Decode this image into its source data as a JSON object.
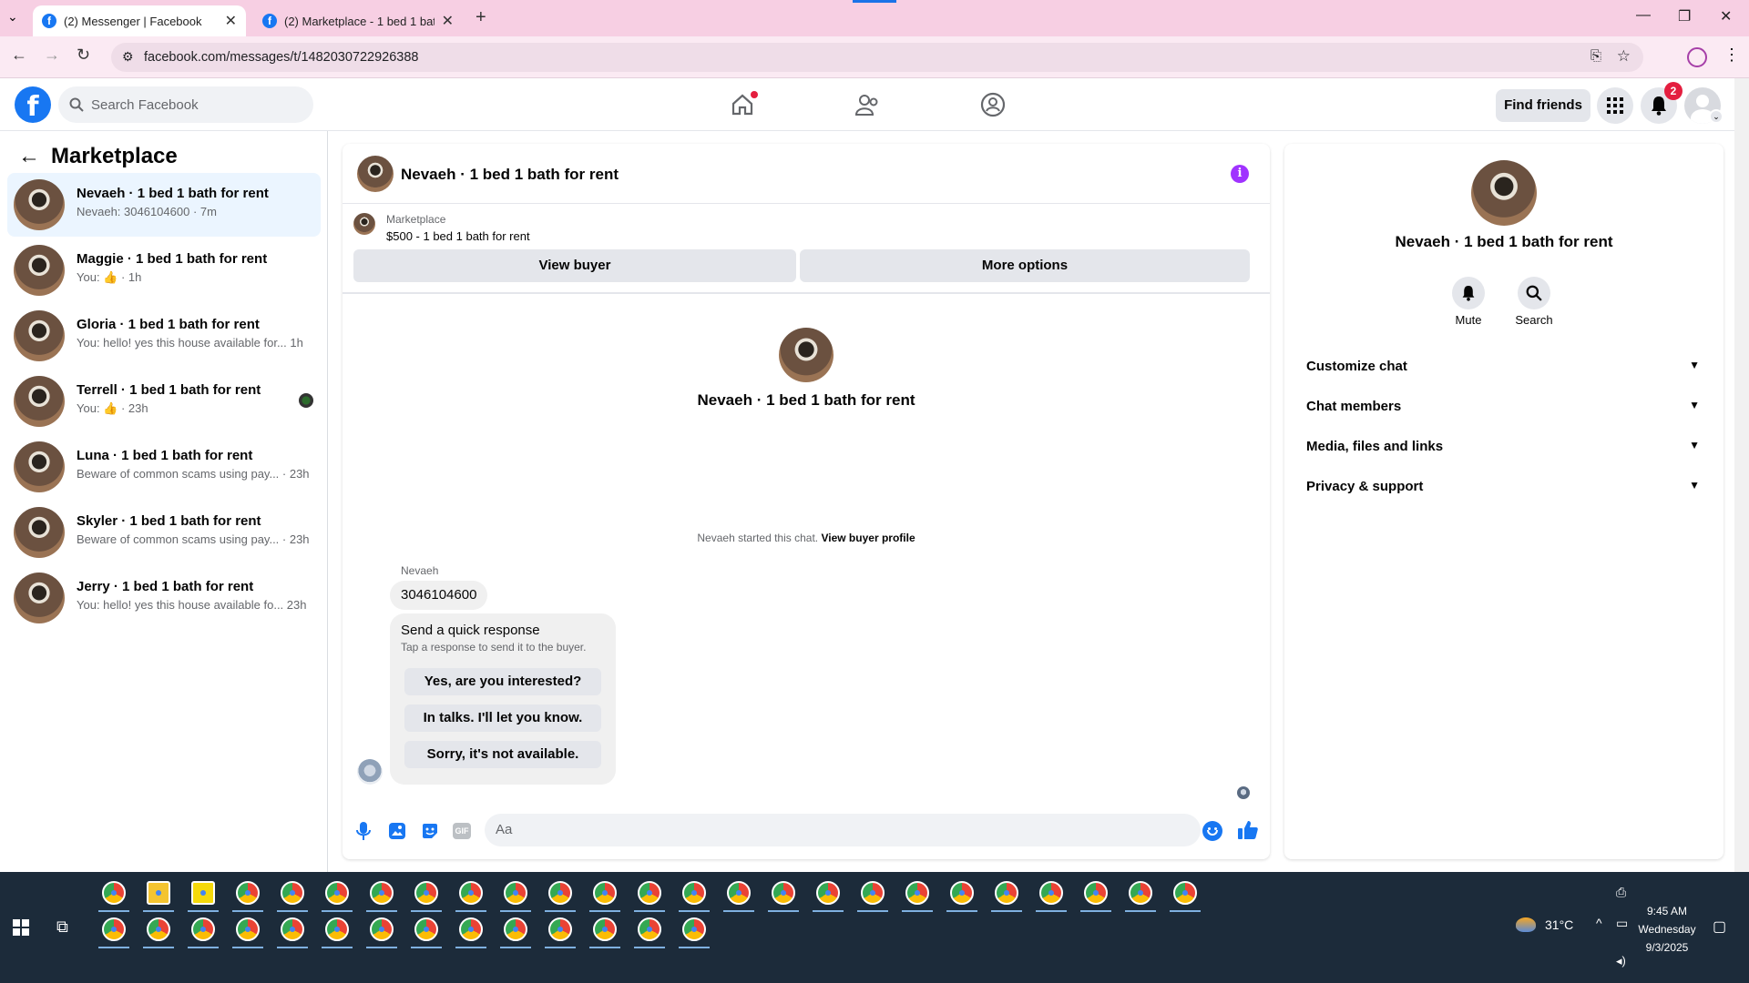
{
  "browser": {
    "tabs": [
      {
        "title": "(2) Messenger | Facebook",
        "active": true
      },
      {
        "title": "(2) Marketplace - 1 bed 1 bath",
        "active": false
      }
    ],
    "url": "facebook.com/messages/t/1482030722926388"
  },
  "fb_header": {
    "logo": "f",
    "search_placeholder": "Search Facebook",
    "find_friends": "Find friends",
    "notification_count": "2"
  },
  "left": {
    "title": "Marketplace",
    "conversations": [
      {
        "name": "Nevaeh · 1 bed 1 bath for rent",
        "preview": "Nevaeh: 3046104600 · 7m",
        "selected": true
      },
      {
        "name": "Maggie · 1 bed 1 bath for rent",
        "preview": "You: 👍 · 1h"
      },
      {
        "name": "Gloria · 1 bed 1 bath for rent",
        "preview": "You: hello! yes this house available for...  1h"
      },
      {
        "name": "Terrell · 1 bed 1 bath for rent",
        "preview": "You: 👍 · 23h"
      },
      {
        "name": "Luna · 1 bed 1 bath for rent",
        "preview": "Beware of common scams using pay... · 23h"
      },
      {
        "name": "Skyler · 1 bed 1 bath for rent",
        "preview": "Beware of common scams using pay... · 23h"
      },
      {
        "name": "Jerry · 1 bed 1 bath for rent",
        "preview": "You: hello! yes this house available fo... 23h"
      }
    ]
  },
  "chat": {
    "title": "Nevaeh · 1 bed 1 bath for rent",
    "listing_source": "Marketplace",
    "listing_line": "$500 - 1 bed 1 bath for rent",
    "view_buyer": "View buyer",
    "more_options": "More options",
    "center_name": "Nevaeh · 1 bed 1 bath for rent",
    "started_text": "Nevaeh started this chat.",
    "view_buyer_profile": "View buyer profile",
    "sender": "Nevaeh",
    "message": "3046104600",
    "quick_title": "Send a quick response",
    "quick_sub": "Tap a response to send it to the buyer.",
    "quick_responses": [
      "Yes, are you interested?",
      "In talks. I'll let you know.",
      "Sorry, it's not available."
    ],
    "composer_placeholder": "Aa"
  },
  "right": {
    "name": "Nevaeh · 1 bed 1 bath for rent",
    "mute": "Mute",
    "search": "Search",
    "sections": [
      "Customize chat",
      "Chat members",
      "Media, files and links",
      "Privacy & support"
    ]
  },
  "taskbar": {
    "temperature": "31°C",
    "time": "9:45 AM",
    "day": "Wednesday",
    "date": "9/3/2025"
  },
  "colors": {
    "accent": "#1877f2",
    "purple": "#a033ff",
    "badge": "#e41e3f"
  }
}
